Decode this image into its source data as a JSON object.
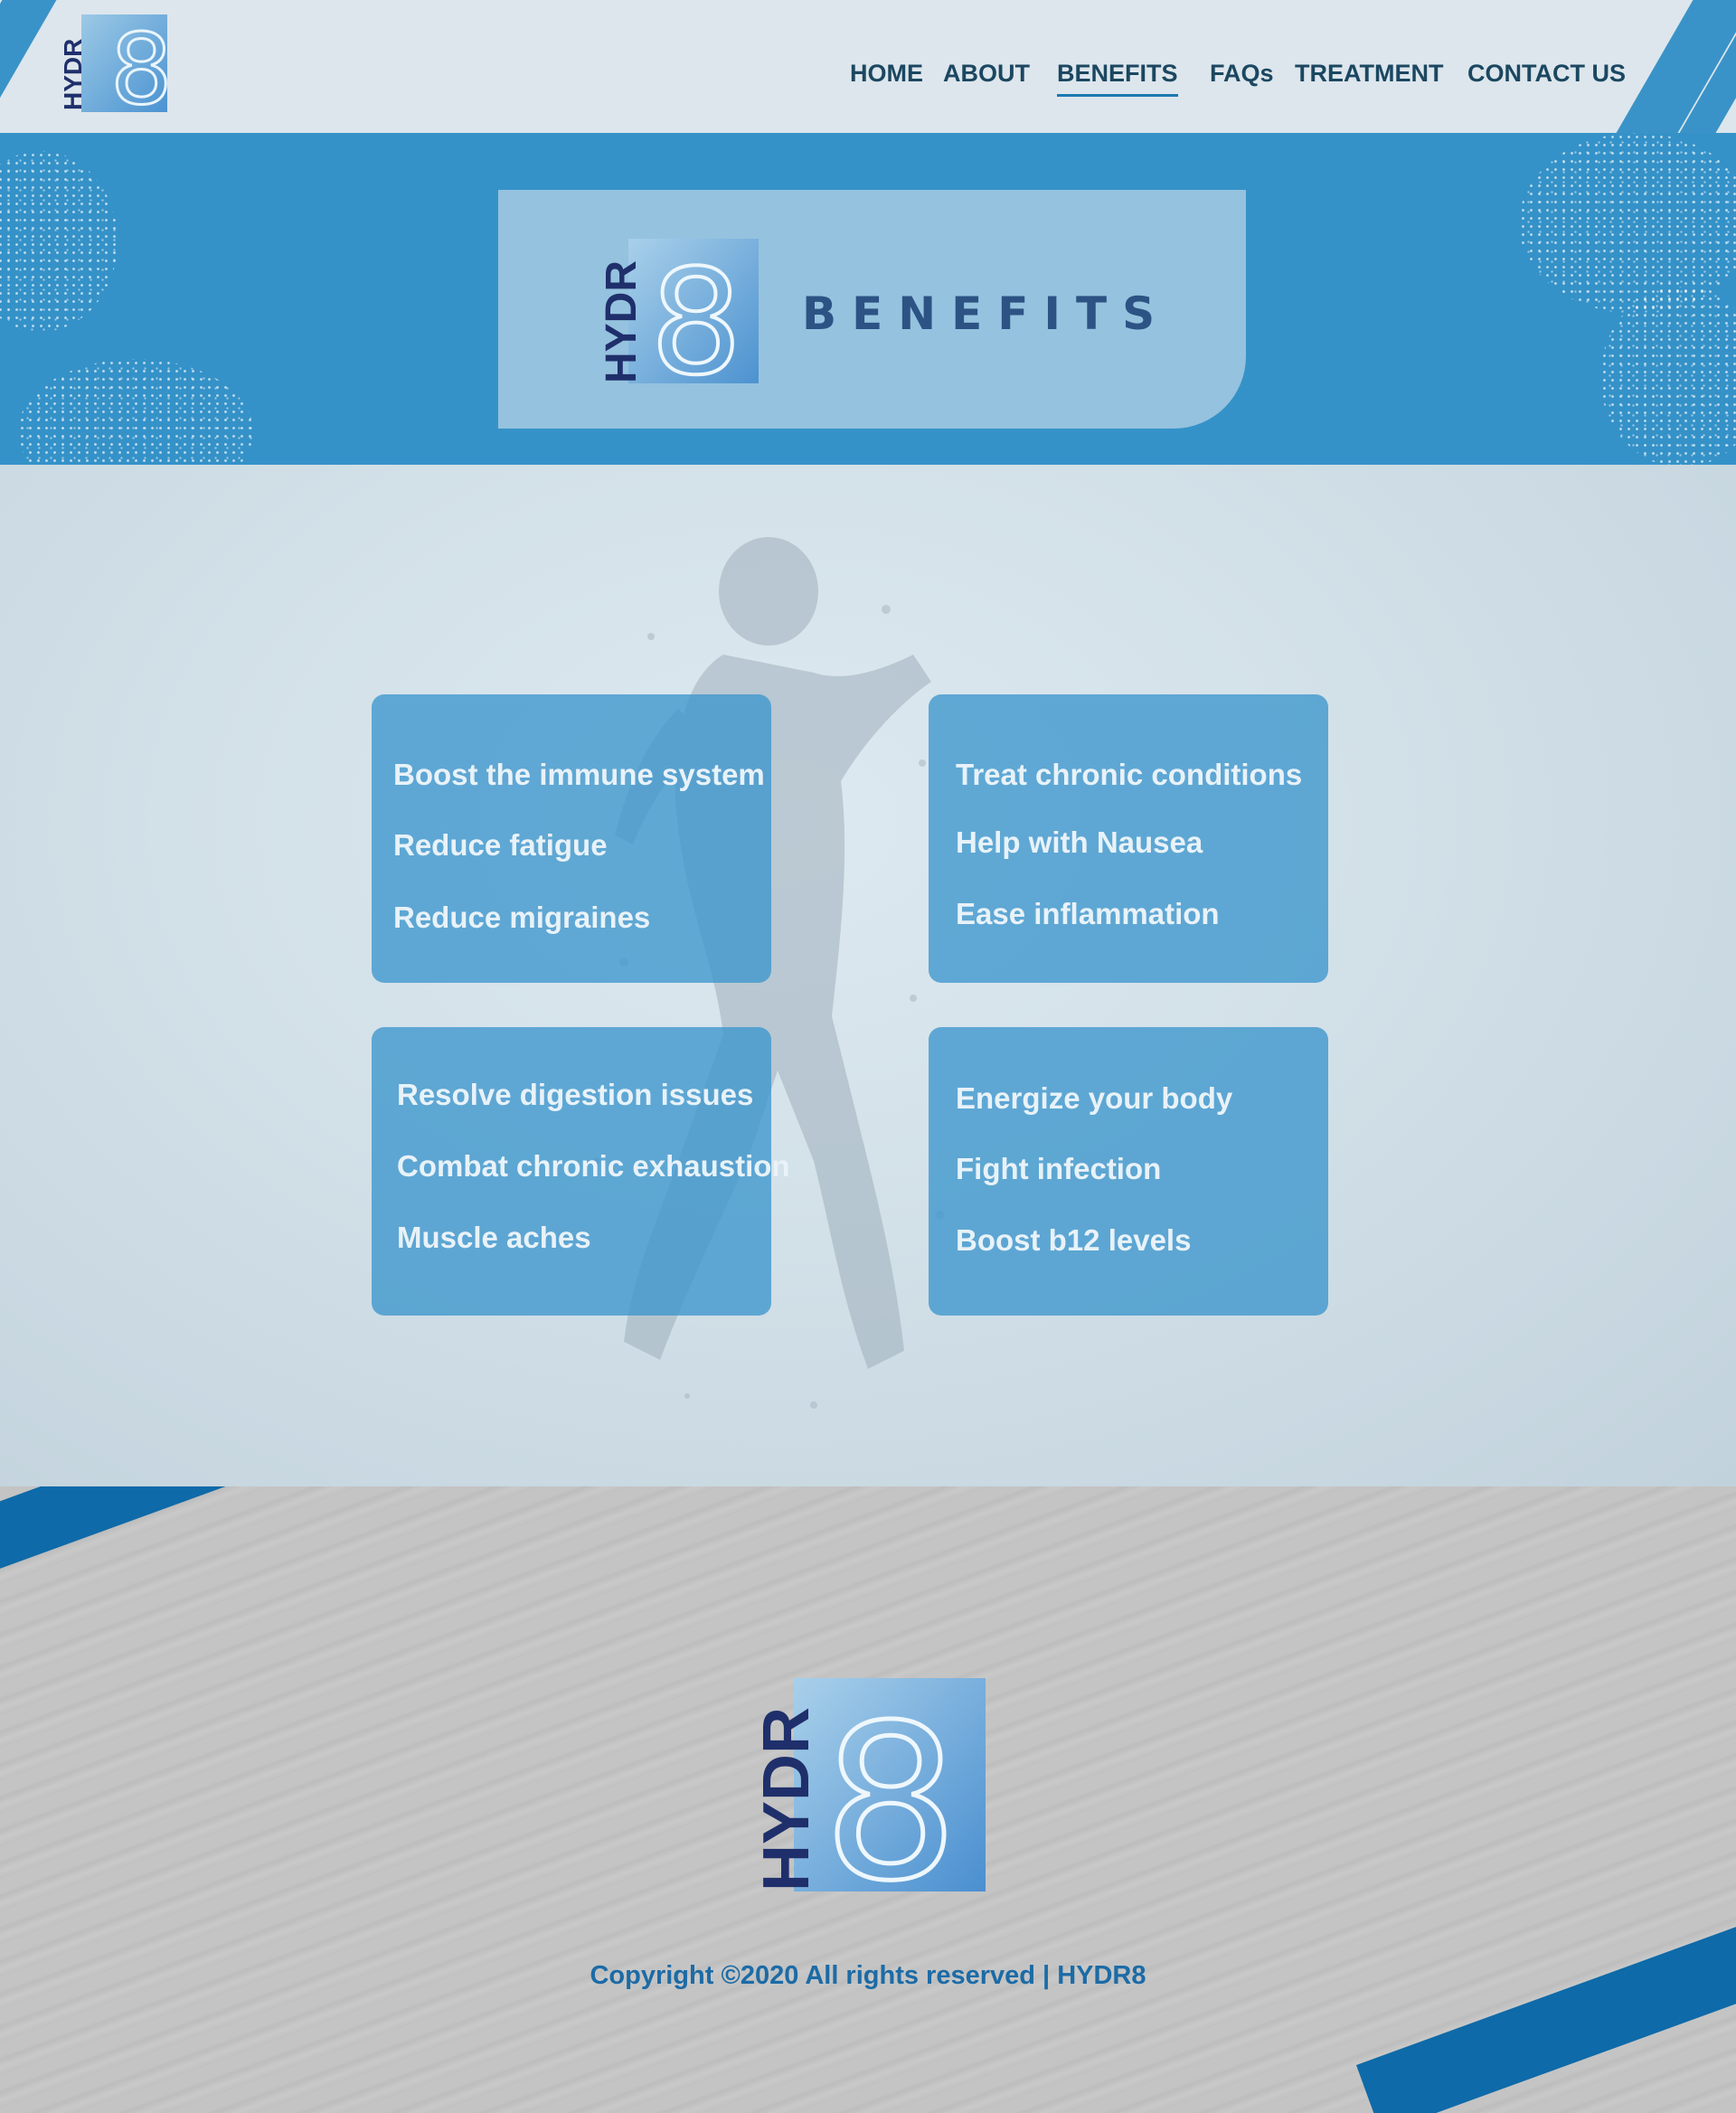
{
  "brand": {
    "logo_text": "HYDR",
    "logo_digit": "8"
  },
  "nav": {
    "items": [
      {
        "label": "HOME"
      },
      {
        "label": "ABOUT"
      },
      {
        "label": "BENEFITS",
        "active": true
      },
      {
        "label": "FAQs"
      },
      {
        "label": "TREATMENT"
      },
      {
        "label": "CONTACT US"
      }
    ]
  },
  "hero": {
    "title": "BENEFITS"
  },
  "benefits": {
    "cards": [
      {
        "items": [
          "Boost the immune system",
          "Reduce fatigue",
          "Reduce migraines"
        ]
      },
      {
        "items": [
          "Treat chronic conditions",
          "Help with Nausea",
          "Ease inflammation"
        ]
      },
      {
        "items": [
          "Resolve digestion issues",
          "Combat chronic exhaustion",
          "Muscle aches"
        ]
      },
      {
        "items": [
          "Energize your body",
          "Fight infection",
          "Boost b12 levels"
        ]
      }
    ]
  },
  "footer": {
    "copyright": "Copyright ©2020 All rights reserved | HYDR8"
  },
  "colors": {
    "primary_blue": "#3592c8",
    "nav_text": "#1b4761",
    "hero_title": "#2c5384",
    "footer_band": "#0e6aa8",
    "copyright": "#1c6ba6"
  }
}
